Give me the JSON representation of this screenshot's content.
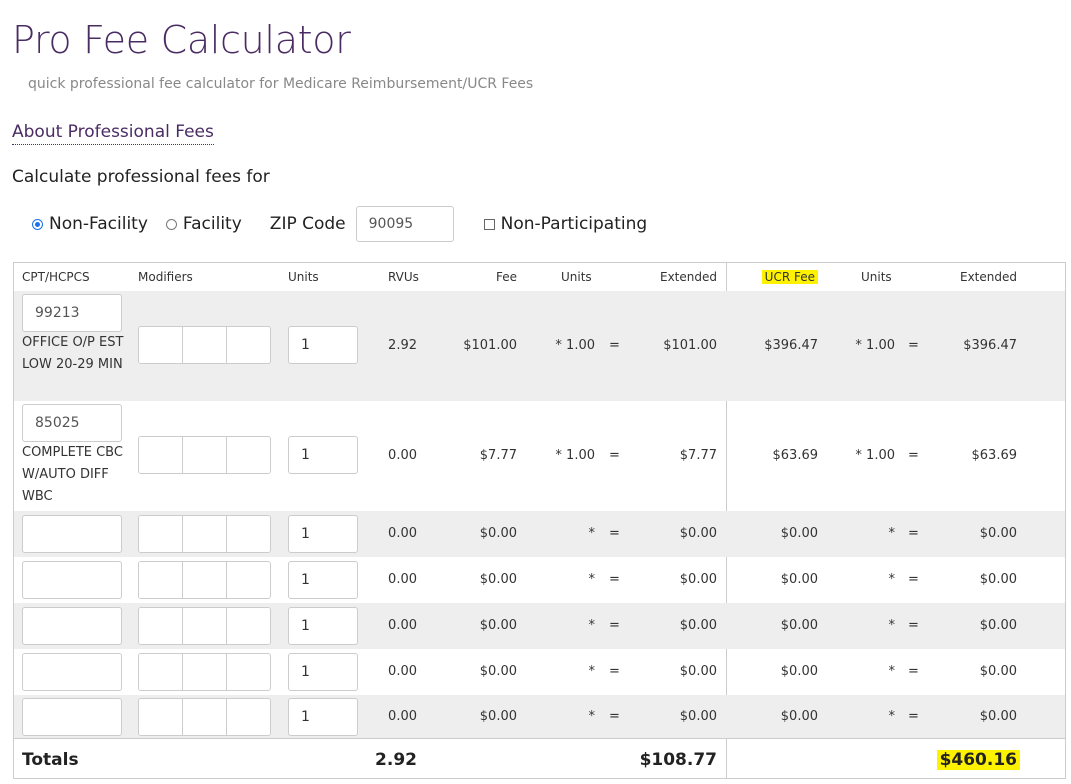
{
  "header": {
    "title": "Pro Fee Calculator",
    "subtitle": "quick professional fee calculator for Medicare Reimbursement/UCR Fees",
    "about_link": "About Professional Fees",
    "calc_label": "Calculate professional fees for"
  },
  "options": {
    "non_facility": "Non-Facility",
    "facility": "Facility",
    "selected": "Non-Facility",
    "zip_label": "ZIP Code",
    "zip_value": "90095",
    "non_participating": "Non-Participating",
    "non_participating_checked": false
  },
  "table": {
    "headers": {
      "code": "CPT/HCPCS",
      "modifiers": "Modifiers",
      "units": "Units",
      "rvus": "RVUs",
      "fee": "Fee",
      "units2": "Units",
      "extended": "Extended",
      "ucr_fee": "UCR Fee",
      "units3": "Units",
      "extended2": "Extended"
    },
    "rows": [
      {
        "code": "99213",
        "desc": "OFFICE O/P EST LOW 20-29 MIN",
        "units": "1",
        "rvus": "2.92",
        "fee": "$101.00",
        "mult": "* 1.00",
        "eq": "=",
        "extended": "$101.00",
        "ucr": "$396.47",
        "ucr_mult": "* 1.00",
        "ucr_eq": "=",
        "ucr_extended": "$396.47"
      },
      {
        "code": "85025",
        "desc": "COMPLETE CBC W/AUTO DIFF WBC",
        "units": "1",
        "rvus": "0.00",
        "fee": "$7.77",
        "mult": "* 1.00",
        "eq": "=",
        "extended": "$7.77",
        "ucr": "$63.69",
        "ucr_mult": "* 1.00",
        "ucr_eq": "=",
        "ucr_extended": "$63.69"
      },
      {
        "code": "",
        "desc": "",
        "units": "1",
        "rvus": "0.00",
        "fee": "$0.00",
        "mult": "*",
        "eq": "=",
        "extended": "$0.00",
        "ucr": "$0.00",
        "ucr_mult": "*",
        "ucr_eq": "=",
        "ucr_extended": "$0.00"
      },
      {
        "code": "",
        "desc": "",
        "units": "1",
        "rvus": "0.00",
        "fee": "$0.00",
        "mult": "*",
        "eq": "=",
        "extended": "$0.00",
        "ucr": "$0.00",
        "ucr_mult": "*",
        "ucr_eq": "=",
        "ucr_extended": "$0.00"
      },
      {
        "code": "",
        "desc": "",
        "units": "1",
        "rvus": "0.00",
        "fee": "$0.00",
        "mult": "*",
        "eq": "=",
        "extended": "$0.00",
        "ucr": "$0.00",
        "ucr_mult": "*",
        "ucr_eq": "=",
        "ucr_extended": "$0.00"
      },
      {
        "code": "",
        "desc": "",
        "units": "1",
        "rvus": "0.00",
        "fee": "$0.00",
        "mult": "*",
        "eq": "=",
        "extended": "$0.00",
        "ucr": "$0.00",
        "ucr_mult": "*",
        "ucr_eq": "=",
        "ucr_extended": "$0.00"
      },
      {
        "code": "",
        "desc": "",
        "units": "1",
        "rvus": "0.00",
        "fee": "$0.00",
        "mult": "*",
        "eq": "=",
        "extended": "$0.00",
        "ucr": "$0.00",
        "ucr_mult": "*",
        "ucr_eq": "=",
        "ucr_extended": "$0.00"
      }
    ],
    "totals": {
      "label": "Totals",
      "rvus": "2.92",
      "extended": "$108.77",
      "ucr_extended": "$460.16"
    }
  },
  "colors": {
    "title": "#4a2c63",
    "highlight": "#fff200",
    "row_shade": "#eeeeee"
  }
}
